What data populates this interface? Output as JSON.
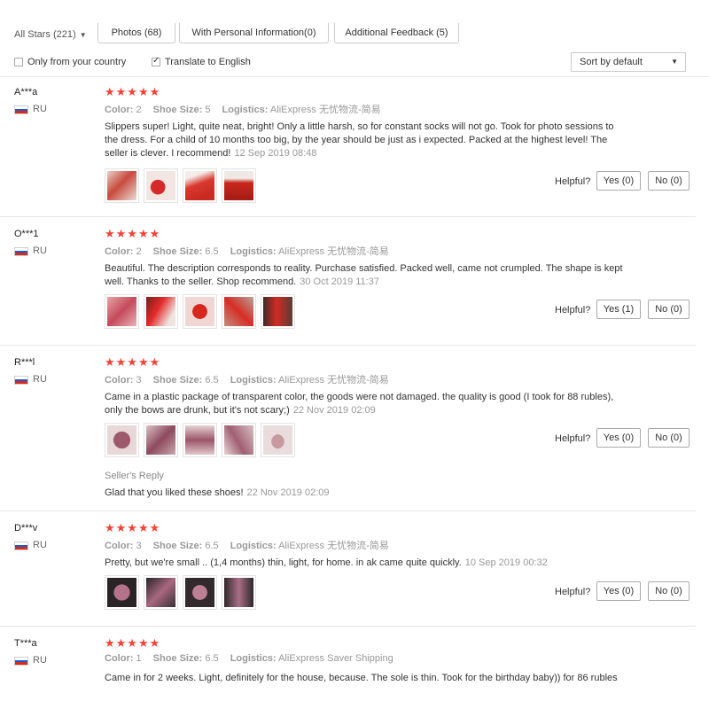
{
  "filters": {
    "stars_select": "All Stars (221)",
    "tabs": [
      "Photos (68)",
      "With Personal Information(0)",
      "Additional Feedback (5)"
    ],
    "only_country": {
      "label": "Only from your country",
      "checked": false
    },
    "translate": {
      "label": "Translate to English",
      "checked": true
    },
    "sort": "Sort by default"
  },
  "labels": {
    "color": "Color:",
    "shoe_size": "Shoe Size:",
    "logistics": "Logistics:",
    "helpful": "Helpful?",
    "seller_reply": "Seller's Reply"
  },
  "colors": {
    "star": "#f44336",
    "muted": "#999999"
  },
  "reviews": [
    {
      "user": "A***a",
      "country": "RU",
      "stars": "★★★★★",
      "color": "2",
      "size": "5",
      "logistics": "AliExpress 无忧物流-简易",
      "text": "Slippers super! Light, quite neat, bright! Only a little harsh, so for constant socks will not go. Took for photo sessions to the dress. For a child of 10 months too big, by the year should be just as i expected. Packed at the highest level! The seller is clever. I recommend!",
      "date": "12 Sep 2019 08:48",
      "yes": "Yes (0)",
      "no": "No (0)",
      "photos": [
        "red slippers on white",
        "red slippers close-up",
        "red slipper side view",
        "red slipper sole"
      ]
    },
    {
      "user": "O***1",
      "country": "RU",
      "stars": "★★★★★",
      "color": "2",
      "size": "6.5",
      "logistics": "AliExpress 无忧物流-简易",
      "text": "Beautiful. The description corresponds to reality. Purchase satisfied. Packed well, came not crumpled. The shape is kept well. Thanks to the seller. Shop recommend.",
      "date": "30 Oct 2019 11:37",
      "yes": "Yes (1)",
      "no": "No (0)",
      "photos": [
        "pink slippers",
        "red slippers bows",
        "red slipper top",
        "red slipper angle",
        "red slippers pair"
      ]
    },
    {
      "user": "R***l",
      "country": "RU",
      "stars": "★★★★★",
      "color": "3",
      "size": "6.5",
      "logistics": "AliExpress 无忧物流-简易",
      "text": "Came in a plastic package of transparent color, the goods were not damaged. the quality is good (I took for 88 rubles), only the bows are drunk, but it's not scary;)",
      "date": "22 Nov 2019 02:09",
      "yes": "Yes (0)",
      "no": "No (0)",
      "photos": [
        "mauve slippers pair",
        "mauve slippers bows",
        "mauve slippers top",
        "mauve slippers hand",
        "mauve slipper sole"
      ],
      "reply": {
        "text": "Glad that you liked these shoes!",
        "date": "22 Nov 2019 02:09"
      }
    },
    {
      "user": "D***v",
      "country": "RU",
      "stars": "★★★★★",
      "color": "3",
      "size": "6.5",
      "logistics": "AliExpress 无忧物流-简易",
      "text": "Pretty, but we're small .. (1,4 months) thin, light, for home. in ak came quite quickly.",
      "date": "10 Sep 2019 00:32",
      "yes": "Yes (0)",
      "no": "No (0)",
      "photos": [
        "mauve slippers on dark",
        "mauve slippers on dark 2",
        "mauve slippers on dark 3",
        "mauve slippers on dark 4"
      ]
    },
    {
      "user": "T***a",
      "country": "RU",
      "stars": "★★★★★",
      "color": "1",
      "size": "6.5",
      "logistics": "AliExpress Saver Shipping",
      "text": "Came in for 2 weeks. Light, definitely for the house, because. The sole is thin. Took for the birthday baby)) for 86 rubles",
      "date": "",
      "yes": "",
      "no": "",
      "photos": []
    }
  ]
}
